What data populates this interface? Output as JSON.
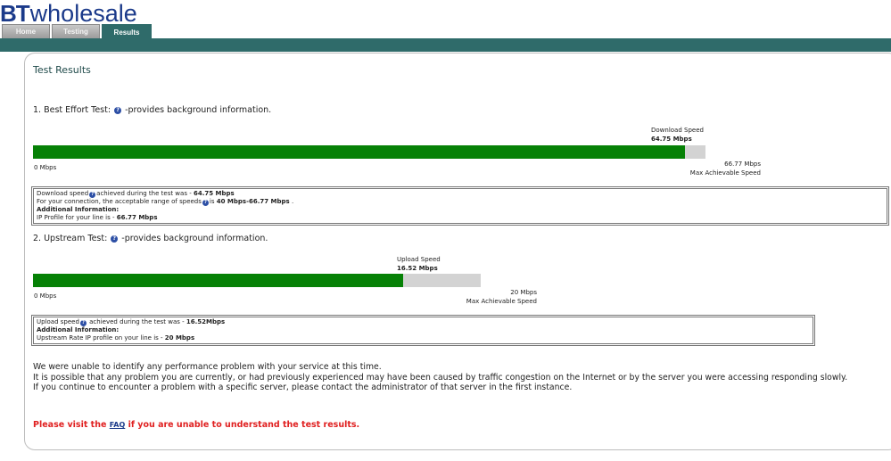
{
  "brand": {
    "logo_bt": "BT",
    "logo_wholesale": "wholesale"
  },
  "tabs": [
    {
      "label": "Home",
      "active": false
    },
    {
      "label": "Testing",
      "active": false
    },
    {
      "label": "Results",
      "active": true
    }
  ],
  "page": {
    "title": "Test Results"
  },
  "best_effort": {
    "heading": "1. Best Effort Test:",
    "heading_suffix": "-provides background information.",
    "speed_label": "Download Speed",
    "speed_value": "64.75 Mbps",
    "measured_mbps": 64.75,
    "max_mbps": 66.77,
    "min_label": "0 Mbps",
    "max_label": "66.77 Mbps",
    "max_caption": "Max Achievable Speed",
    "info": {
      "line1_pre": "Download speed",
      "line1_mid": "achieved during the test was - ",
      "line1_val": "64.75 Mbps",
      "line2_pre": "For your connection, the acceptable range of speeds",
      "line2_mid": "is ",
      "line2_val": "40 Mbps-66.77 Mbps",
      "line2_post": " .",
      "additional": "Additional Information:",
      "line4_pre": "IP Profile for your line is - ",
      "line4_val": "66.77 Mbps"
    }
  },
  "upstream": {
    "heading": "2. Upstream Test:",
    "heading_suffix": "-provides background information.",
    "speed_label": "Upload Speed",
    "speed_value": "16.52 Mbps",
    "measured_mbps": 16.52,
    "max_mbps": 20,
    "min_label": "0 Mbps",
    "max_label": "20 Mbps",
    "max_caption": "Max Achievable Speed",
    "info": {
      "line1_pre": "Upload speed",
      "line1_mid": " achieved during the test was - ",
      "line1_val": "16.52Mbps",
      "additional": "Additional Information:",
      "line3_pre": "Upstream Rate IP profile on your line is - ",
      "line3_val": "20 Mbps"
    }
  },
  "messages": {
    "line1": "We were unable to identify any performance problem with your service at this time.",
    "line2": "It is possible that any problem you are currently, or had previously experienced may have been caused by traffic congestion on the Internet or by the server you were accessing responding slowly.",
    "line3": "If you continue to encounter a problem with a specific server, please contact the administrator of that server in the first instance."
  },
  "faq": {
    "pre": "Please visit the ",
    "link": "FAQ",
    "post": " if you are unable to understand the test results."
  },
  "info_icon_glyph": "?",
  "colors": {
    "brand": "#1b3a8a",
    "bar": "#2f6b6a",
    "fill": "#068106",
    "track": "#d3d3d3",
    "warning": "#e02020"
  }
}
